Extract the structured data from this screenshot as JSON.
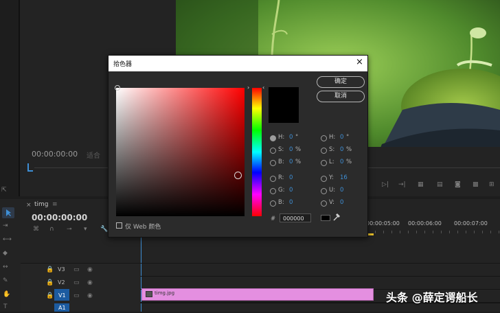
{
  "source_monitor": {
    "timecode": "00:00:00:00",
    "fit_label": "适合"
  },
  "timeline": {
    "tab_title": "timg",
    "timecode": "00:00:00:00",
    "ruler_marks": [
      "00:00:05:00",
      "00:00:06:00",
      "00:00:07:00"
    ],
    "tracks": [
      {
        "name": "V3"
      },
      {
        "name": "V2"
      },
      {
        "name": "V1"
      },
      {
        "name": "A1"
      }
    ],
    "clip_name": "timg.jpg",
    "clip_color": "#e48fe0"
  },
  "color_picker": {
    "title": "拾色器",
    "ok_label": "确定",
    "cancel_label": "取消",
    "web_only_label": "仅 Web 颜色",
    "hex_prefix": "#",
    "hex_value": "000000",
    "left_fields": [
      {
        "key": "H:",
        "value": "0",
        "unit": "°",
        "selected": true
      },
      {
        "key": "S:",
        "value": "0",
        "unit": "%",
        "selected": false
      },
      {
        "key": "B:",
        "value": "0",
        "unit": "%",
        "selected": false
      },
      {
        "key": "R:",
        "value": "0",
        "unit": "",
        "selected": false
      },
      {
        "key": "G:",
        "value": "0",
        "unit": "",
        "selected": false
      },
      {
        "key": "B:",
        "value": "0",
        "unit": "",
        "selected": false
      }
    ],
    "right_fields": [
      {
        "key": "H:",
        "value": "0",
        "unit": "°"
      },
      {
        "key": "S:",
        "value": "0",
        "unit": "%"
      },
      {
        "key": "L:",
        "value": "0",
        "unit": "%"
      },
      {
        "key": "Y:",
        "value": "16",
        "unit": ""
      },
      {
        "key": "U:",
        "value": "0",
        "unit": ""
      },
      {
        "key": "V:",
        "value": "0",
        "unit": ""
      }
    ]
  },
  "watermark": "头条 @薛定谔船长"
}
